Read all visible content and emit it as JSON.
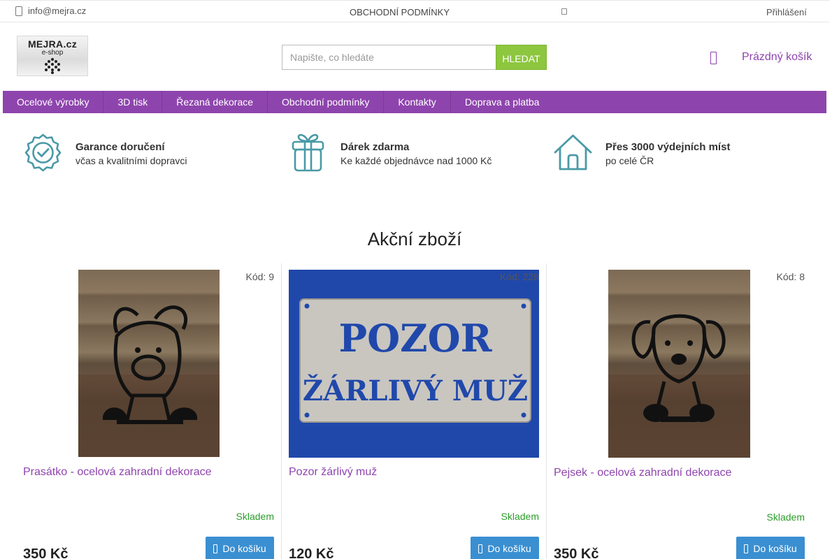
{
  "topbar": {
    "email": "info@mejra.cz",
    "terms": "OBCHODNÍ PODMÍNKY",
    "login": "Přihlášení"
  },
  "logo": {
    "line1": "MEJRA.cz",
    "line2": "e-shop"
  },
  "search": {
    "placeholder": "Napište, co hledáte",
    "button": "HLEDAT"
  },
  "cart": {
    "label": "Prázdný košík"
  },
  "nav": {
    "items": [
      {
        "label": "Ocelové výrobky"
      },
      {
        "label": "3D tisk"
      },
      {
        "label": "Řezaná dekorace"
      },
      {
        "label": "Obchodní podmínky"
      },
      {
        "label": "Kontakty"
      },
      {
        "label": "Doprava a platba"
      }
    ]
  },
  "benefits": [
    {
      "title": "Garance doručení",
      "subtitle": "včas a kvalitními dopravci",
      "icon": "badge-check-icon"
    },
    {
      "title": "Dárek zdarma",
      "subtitle": "Ke každé objednávce nad 1000 Kč",
      "icon": "gift-icon"
    },
    {
      "title": "Přes 3000 výdejních míst",
      "subtitle": "po celé ČR",
      "icon": "house-icon"
    }
  ],
  "section_title": "Akční zboží",
  "products": [
    {
      "code": "Kód: 9",
      "name": "Prasátko - ocelová zahradní dekorace",
      "stock": "Skladem",
      "price": "350 Kč",
      "button": "Do košíku"
    },
    {
      "code": "Kód: 228",
      "name": "Pozor žárlivý muž",
      "stock": "Skladem",
      "price": "120 Kč",
      "button": "Do košíku",
      "sign_line1": "POZOR",
      "sign_line2": "ŽÁRLIVÝ MUŽ"
    },
    {
      "code": "Kód: 8",
      "name": "Pejsek - ocelová zahradní dekorace",
      "stock": "Skladem",
      "price": "350 Kč",
      "button": "Do košíku"
    }
  ],
  "colors": {
    "accent": "#8e44ad",
    "search_button": "#8dc63f",
    "cart_button": "#3a8fd1",
    "stock": "#2a9d2a",
    "icon_teal": "#4a9aa6"
  }
}
